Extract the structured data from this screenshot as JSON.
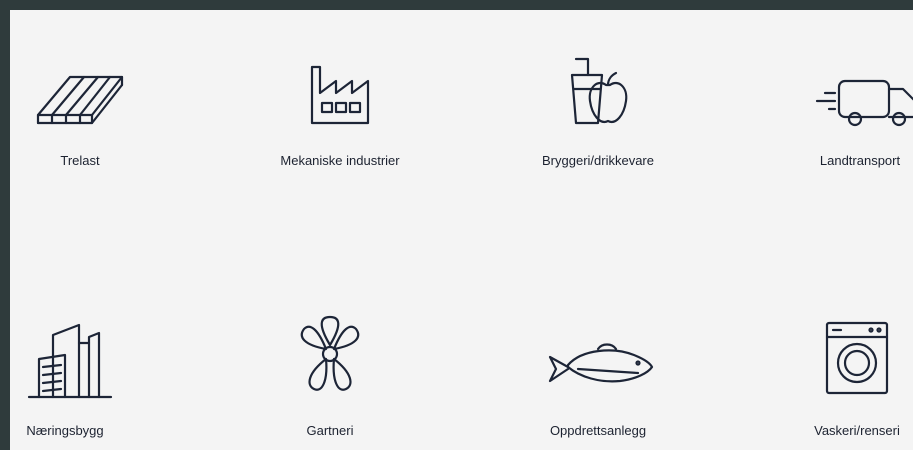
{
  "industries": [
    {
      "label": "Trelast",
      "icon": "lumber-icon"
    },
    {
      "label": "Mekaniske industrier",
      "icon": "factory-icon"
    },
    {
      "label": "Bryggeri/drikkevare",
      "icon": "drink-apple-icon"
    },
    {
      "label": "Landtransport",
      "icon": "truck-icon"
    },
    {
      "label": "Næringsbygg",
      "icon": "commercial-building-icon"
    },
    {
      "label": "Gartneri",
      "icon": "flower-icon"
    },
    {
      "label": "Oppdrettsanlegg",
      "icon": "fish-icon"
    },
    {
      "label": "Vaskeri/renseri",
      "icon": "washing-machine-icon"
    }
  ],
  "colors": {
    "frame": "#2f3b3c",
    "panel": "#f4f4f4",
    "icon_stroke": "#1d2537",
    "text": "#1c2230"
  }
}
